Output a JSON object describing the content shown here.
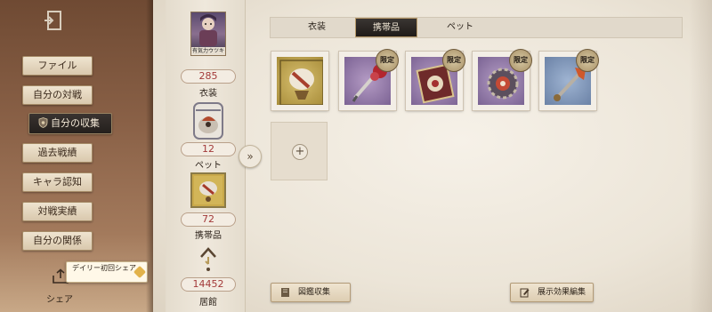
{
  "sidebar": {
    "items": [
      {
        "label": "ファイル"
      },
      {
        "label": "自分の対戦"
      },
      {
        "label": "自分の収集"
      },
      {
        "label": "過去戦績"
      },
      {
        "label": "キャラ認知"
      },
      {
        "label": "対戦実績"
      },
      {
        "label": "自分の関係"
      }
    ],
    "share_label": "シェア",
    "share_tip": "デイリー初回シェア"
  },
  "stats": {
    "costume_value": "285",
    "costume_label": "衣装",
    "costume_thumb_text": "有気力ウツキ",
    "pet_value": "12",
    "pet_label": "ペット",
    "portable_value": "72",
    "portable_label": "携帯品",
    "residence_value": "14452",
    "residence_label": "居館"
  },
  "tabs": [
    {
      "label": "衣装"
    },
    {
      "label": "携帯品"
    },
    {
      "label": "ペット"
    }
  ],
  "stamps": {
    "limited_label": "限定"
  },
  "bottom": {
    "codex_label": "図鑑収集",
    "effect_label": "展示効果編集"
  },
  "colors": {
    "accent_red": "#a33a3a",
    "active_dark": "#241f1c",
    "leather": "#8a6147"
  }
}
